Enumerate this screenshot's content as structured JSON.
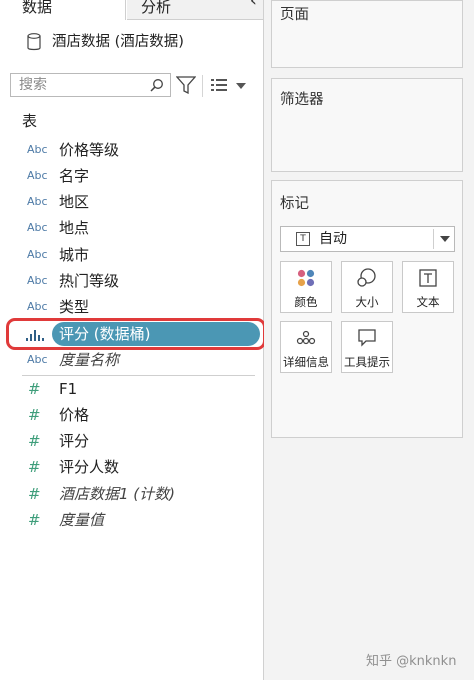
{
  "tabs": {
    "data": "数据",
    "analysis": "分析"
  },
  "datasource": {
    "label": "酒店数据 (酒店数据)"
  },
  "search": {
    "placeholder": "搜索"
  },
  "section": {
    "title": "表"
  },
  "fields": {
    "dimensions": [
      {
        "type": "Abc",
        "label": "价格等级"
      },
      {
        "type": "Abc",
        "label": "名字"
      },
      {
        "type": "Abc",
        "label": "地区"
      },
      {
        "type": "Abc",
        "label": "地点"
      },
      {
        "type": "Abc",
        "label": "城市"
      },
      {
        "type": "Abc",
        "label": "热门等级"
      },
      {
        "type": "Abc",
        "label": "类型"
      }
    ],
    "selected": {
      "label": "评分 (数据桶)"
    },
    "measure_names": {
      "type": "Abc",
      "label": "度量名称"
    },
    "measures": [
      {
        "type": "#",
        "label": "F1"
      },
      {
        "type": "#",
        "label": "价格"
      },
      {
        "type": "#",
        "label": "评分"
      },
      {
        "type": "#",
        "label": "评分人数"
      },
      {
        "type": "#",
        "label": "酒店数据1 (计数)"
      },
      {
        "type": "#",
        "label": "度量值"
      }
    ]
  },
  "cards": {
    "pages": {
      "title": "页面"
    },
    "filters": {
      "title": "筛选器"
    },
    "marks": {
      "title": "标记",
      "type_value": "自动",
      "buttons": [
        {
          "label": "颜色",
          "icon": "color-dots-icon"
        },
        {
          "label": "大小",
          "icon": "size-circles-icon"
        },
        {
          "label": "文本",
          "icon": "text-box-icon"
        },
        {
          "label": "详细信息",
          "icon": "detail-dots-icon"
        },
        {
          "label": "工具提示",
          "icon": "tooltip-bubble-icon"
        }
      ]
    }
  },
  "watermark": "知乎 @knknkn",
  "colors": {
    "selected_pill": "#4b97b4",
    "highlight": "#e03a3a",
    "type_text": "#4d7aa6",
    "measure_hash": "#3f9e7b"
  }
}
